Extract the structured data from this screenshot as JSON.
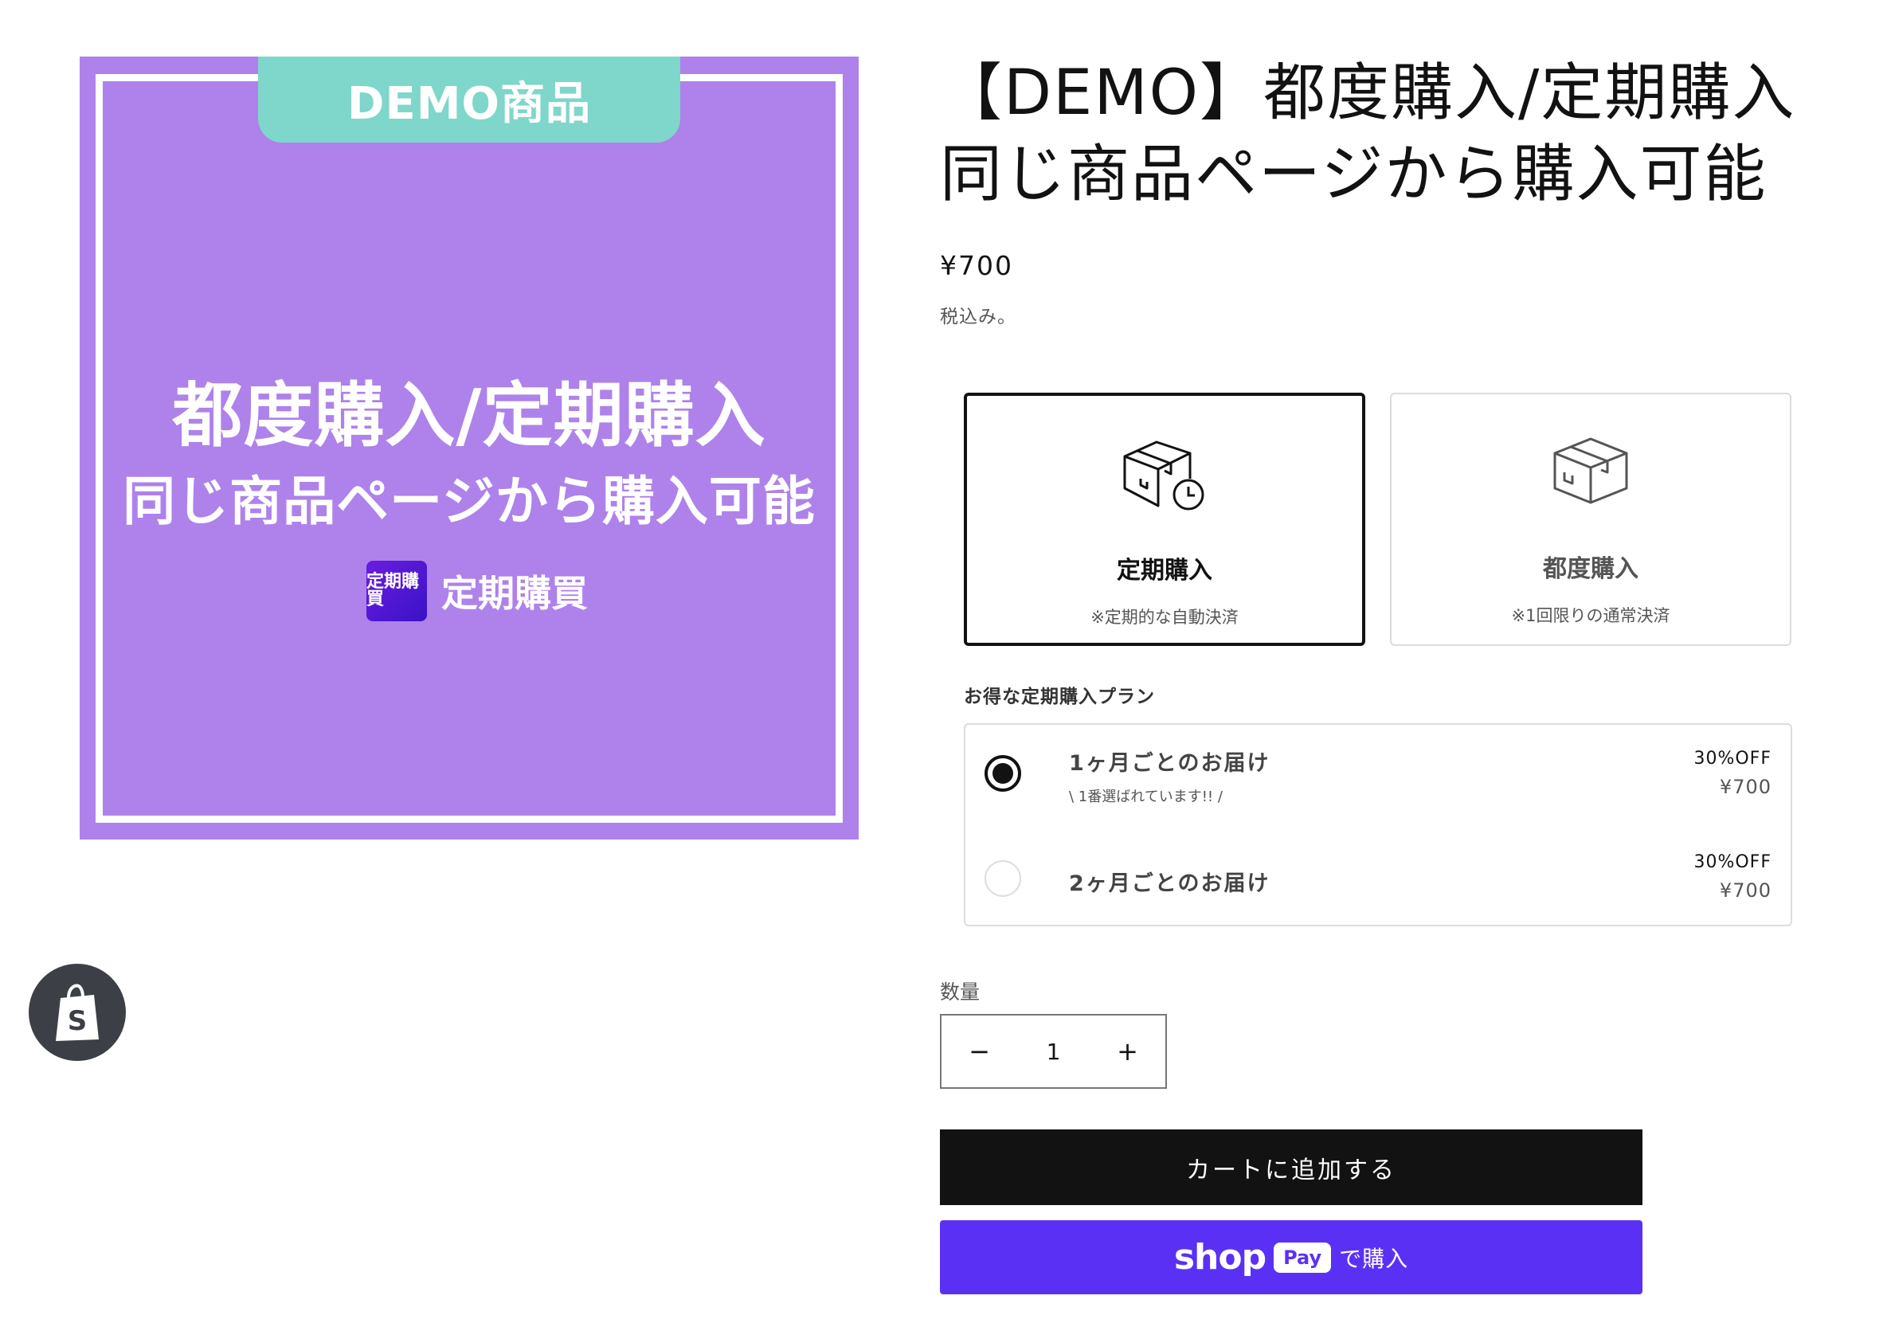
{
  "product_image": {
    "tag": "DEMO商品",
    "line1": "都度購入/定期購入",
    "line2": "同じ商品ページから購入可能",
    "brand_logo_text": "定期購買",
    "brand_name": "定期購買",
    "background_color": "#ae82ea",
    "tag_color": "#7fd6cb"
  },
  "product": {
    "title": "【DEMO】都度購入/定期購入同じ商品ページから購入可能",
    "price": "¥700",
    "tax_note": "税込み。"
  },
  "purchase_types": [
    {
      "label": "定期購入",
      "sublabel": "※定期的な自動決済",
      "icon": "box-clock-icon",
      "selected": true
    },
    {
      "label": "都度購入",
      "sublabel": "※1回限りの通常決済",
      "icon": "box-icon",
      "selected": false
    }
  ],
  "plans": {
    "heading": "お得な定期購入プラン",
    "items": [
      {
        "name": "1ヶ月ごとのお届け",
        "tagline": "\\ 1番選ばれています!! /",
        "discount": "30%OFF",
        "price": "¥700",
        "selected": true
      },
      {
        "name": "2ヶ月ごとのお届け",
        "discount": "30%OFF",
        "price": "¥700",
        "selected": false
      }
    ]
  },
  "quantity": {
    "label": "数量",
    "value": "1",
    "minus": "−",
    "plus": "+"
  },
  "buttons": {
    "add_to_cart": "カートに追加する",
    "shop_word": "shop",
    "pay_pill": "Pay",
    "buy_text": "で購入"
  },
  "colors": {
    "accent_dark": "#121212",
    "shop_pay": "#5a31f4",
    "shopify_badge": "#3c4046"
  }
}
